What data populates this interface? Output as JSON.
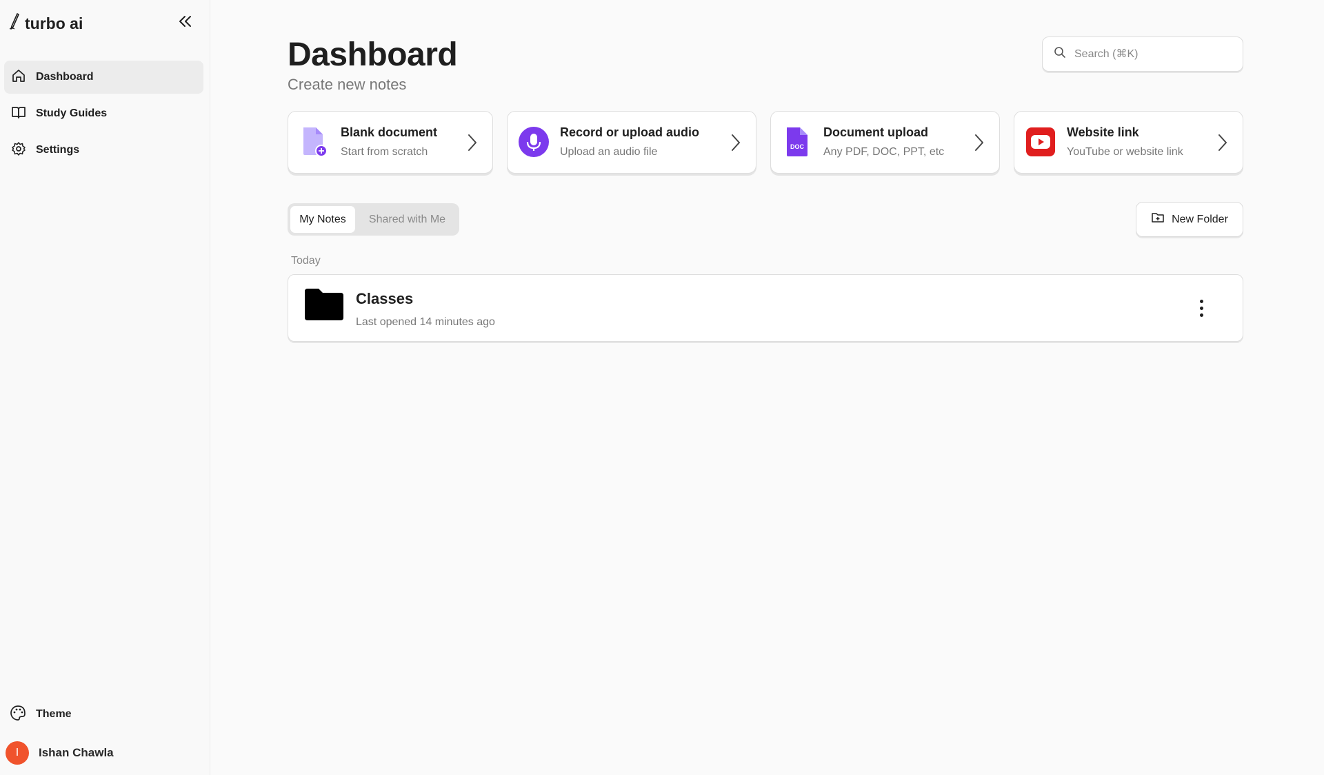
{
  "brand": {
    "name": "turbo ai"
  },
  "sidebar": {
    "items": [
      {
        "label": "Dashboard",
        "icon": "home-icon",
        "active": true
      },
      {
        "label": "Study Guides",
        "icon": "book-icon",
        "active": false
      },
      {
        "label": "Settings",
        "icon": "gear-icon",
        "active": false
      }
    ],
    "theme_label": "Theme",
    "user": {
      "name": "Ishan Chawla",
      "initial": "I",
      "avatar_color": "#f0532c"
    }
  },
  "header": {
    "title": "Dashboard",
    "subtitle": "Create new notes"
  },
  "search": {
    "placeholder": "Search (⌘K)",
    "value": ""
  },
  "cards": [
    {
      "title": "Blank document",
      "subtitle": "Start from scratch",
      "icon": "blank-document-icon",
      "accent": "#8b5cf6"
    },
    {
      "title": "Record or upload audio",
      "subtitle": "Upload an audio file",
      "icon": "microphone-icon",
      "accent": "#7c3aed"
    },
    {
      "title": "Document upload",
      "subtitle": "Any PDF, DOC, PPT, etc",
      "icon": "doc-file-icon",
      "accent": "#7c3aed",
      "icon_text": "DOC"
    },
    {
      "title": "Website link",
      "subtitle": "YouTube or website link",
      "icon": "youtube-icon",
      "accent": "#e01e1e"
    }
  ],
  "tabs": [
    {
      "label": "My Notes",
      "active": true
    },
    {
      "label": "Shared with Me",
      "active": false
    }
  ],
  "new_folder_label": "New Folder",
  "notes": {
    "section_label": "Today",
    "items": [
      {
        "name": "Classes",
        "meta": "Last opened 14 minutes ago",
        "icon": "folder-icon"
      }
    ]
  }
}
